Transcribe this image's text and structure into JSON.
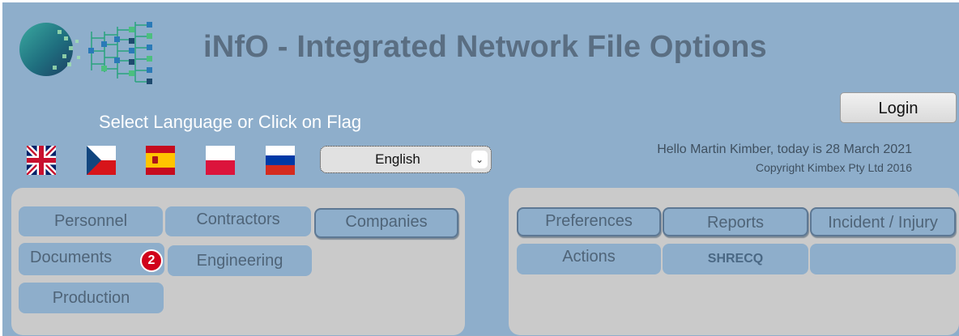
{
  "header": {
    "title": "iNfO - Integrated Network File Options",
    "logo": "circuit-tree-logo"
  },
  "login": {
    "label": "Login"
  },
  "language": {
    "prompt": "Select Language or Click on Flag",
    "selected": "English",
    "flags": [
      "uk-flag",
      "czech-flag",
      "spain-flag",
      "poland-flag",
      "russia-flag"
    ]
  },
  "user": {
    "greeting": "Hello Martin Kimber, today is 28 March 2021",
    "copyright": "Copyright Kimbex Pty Ltd 2016"
  },
  "left_menu": {
    "personnel": "Personnel",
    "contractors": "Contractors",
    "companies": "Companies",
    "documents": "Documents",
    "documents_badge": "2",
    "engineering": "Engineering",
    "production": "Production"
  },
  "right_menu": {
    "preferences": "Preferences",
    "reports": "Reports",
    "incident": "Incident / Injury",
    "actions": "Actions",
    "shrecq": "SHRECQ"
  },
  "colors": {
    "background": "#8eaecb",
    "panel": "#cacaca",
    "button": "#8eaecb",
    "title": "#5a6e82",
    "badge": "#d0021b"
  }
}
